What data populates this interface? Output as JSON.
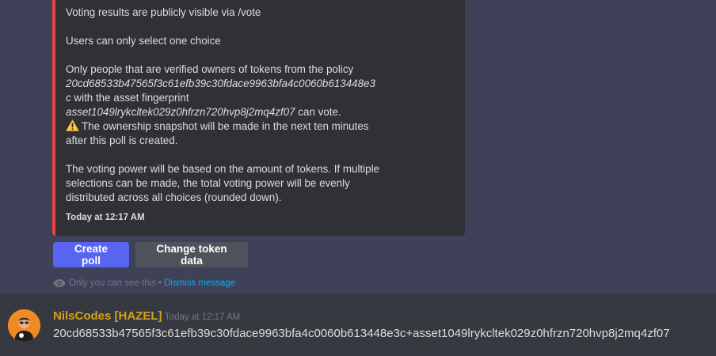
{
  "embed": {
    "line_visibility": "Voting results are publicly visible via /vote",
    "line_single_choice": "Users can only select one choice",
    "line_policy_intro": "Only people that are verified owners of tokens from the policy",
    "policy_id_part1": "20cd68533b47565f3c61efb39c30fdace9963bfa4c0060b613448e3",
    "policy_id_part2": "c",
    "line_fingerprint_intro": " with the asset fingerprint",
    "fingerprint": "asset1049lrykcltek029z0hfrzn720hvp8j2mq4zf07",
    "line_can_vote": " can vote.",
    "warning_icon": "warning-icon",
    "line_snapshot_1": "The ownership snapshot will be made in the next ten minutes",
    "line_snapshot_2": "after this poll is created.",
    "line_power_1": "The voting power will be based on the amount of tokens. If multiple",
    "line_power_2": "selections can be made, the total voting power will be evenly",
    "line_power_3": "distributed across all choices (rounded down).",
    "timestamp": "Today at 12:17 AM",
    "accent_color": "#ed4245"
  },
  "buttons": {
    "create_poll": "Create poll",
    "change_token_data": "Change token data"
  },
  "ephemeral_note": {
    "icon": "eye-icon",
    "text": "Only you can see this",
    "separator": "•",
    "dismiss": "Dismiss message"
  },
  "message": {
    "username": "NilsCodes [HAZEL]",
    "timestamp": "Today at 12:17 AM",
    "content": "20cd68533b47565f3c61efb39c30fdace9963bfa4c0060b613448e3c+asset1049lrykcltek029z0hfrzn720hvp8j2mq4zf07",
    "username_color": "#d4a017"
  }
}
